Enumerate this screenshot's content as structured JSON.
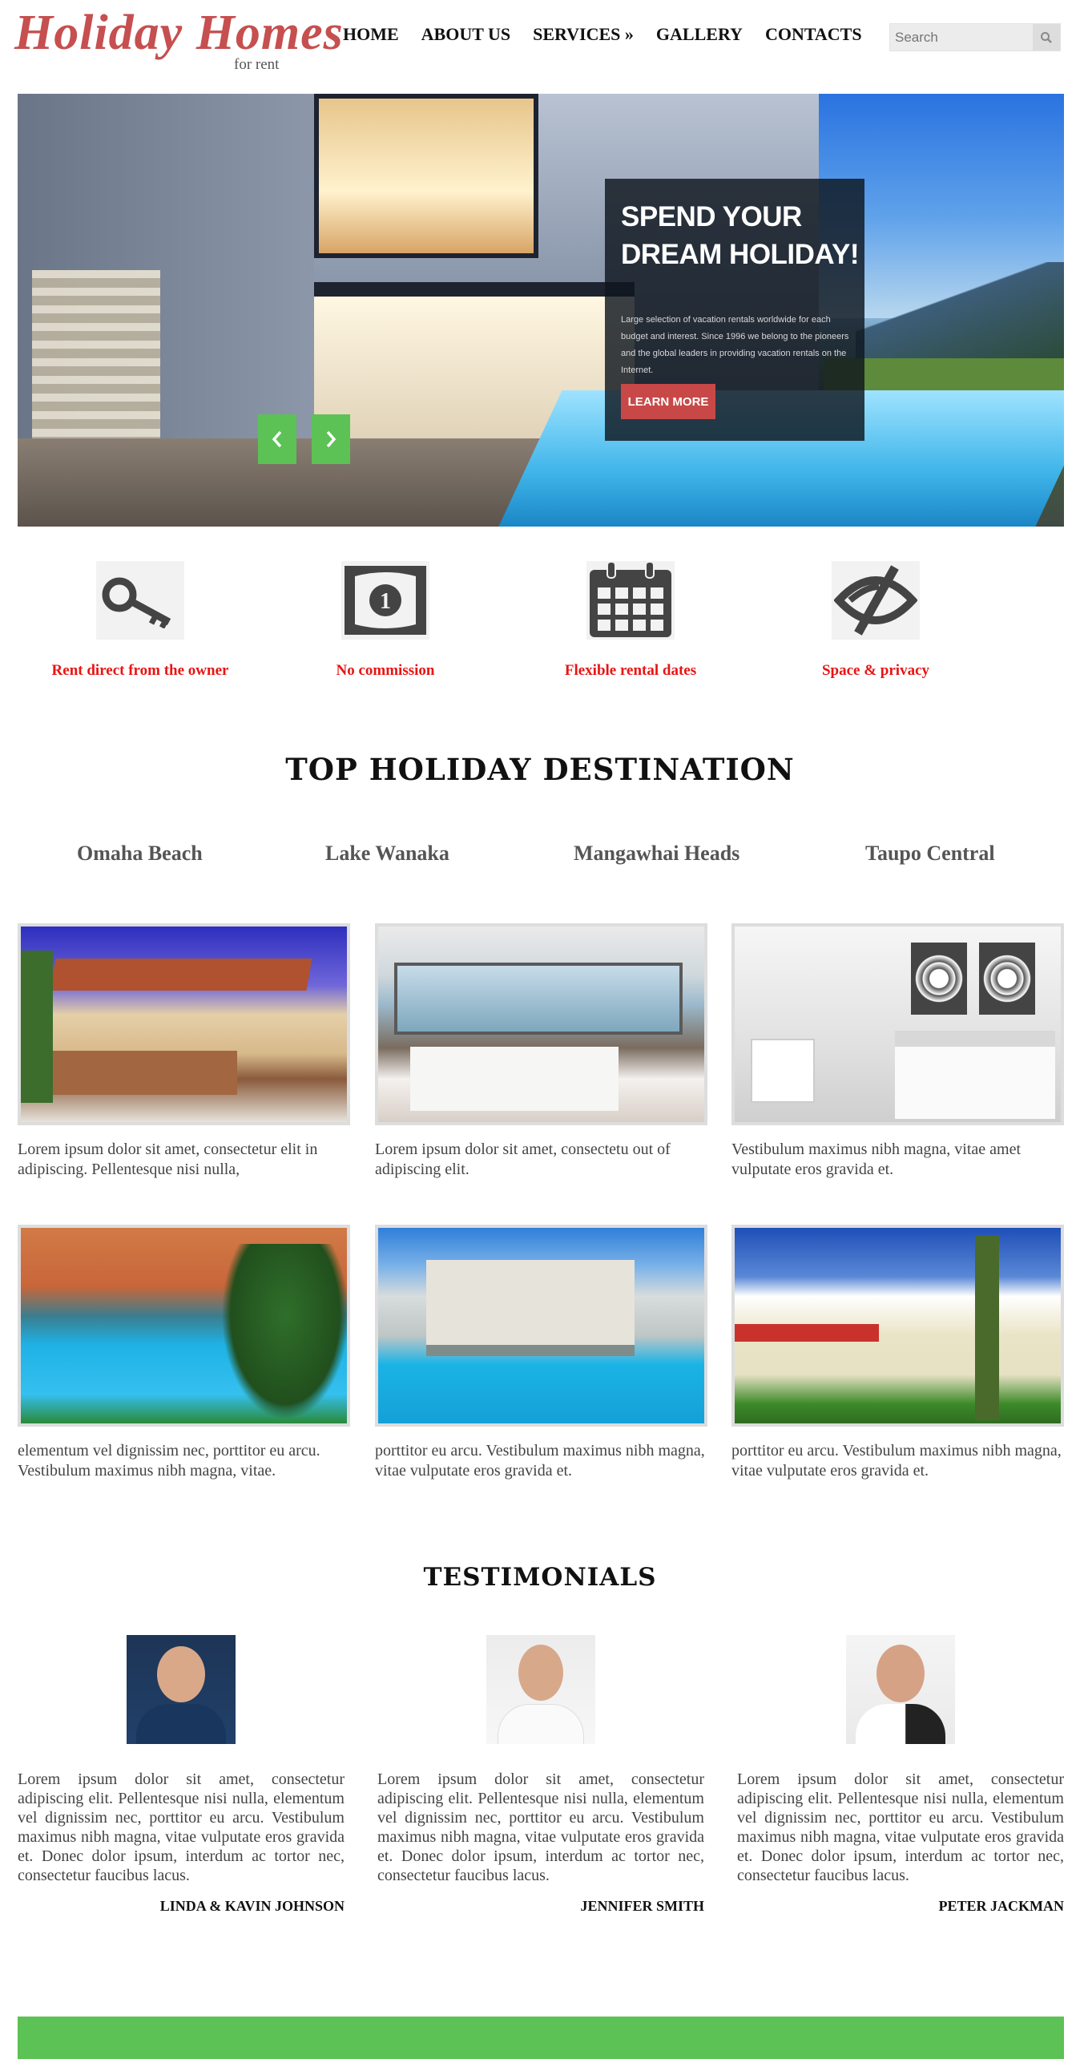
{
  "brand": {
    "title": "Holiday Homes",
    "subtitle": "for rent"
  },
  "nav": {
    "items": [
      "HOME",
      "ABOUT US",
      "SERVICES »",
      "GALLERY",
      "CONTACTS"
    ]
  },
  "search": {
    "placeholder": "Search"
  },
  "hero": {
    "title": "SPEND YOUR DREAM HOLIDAY!",
    "text": "Large selection of vacation rentals worldwide for each budget and interest. Since 1996 we belong to the pioneers and the global leaders in providing vacation rentals on the Internet.",
    "button": "LEARN MORE"
  },
  "features": [
    {
      "label": "Rent direct from the owner",
      "icon": "key-icon"
    },
    {
      "label": "No commission",
      "icon": "banknote-icon"
    },
    {
      "label": "Flexible rental dates",
      "icon": "calendar-icon"
    },
    {
      "label": "Space & privacy",
      "icon": "hidden-eye-icon"
    }
  ],
  "destinations": {
    "title": "TOP HOLIDAY DESTINATION",
    "names": [
      "Omaha Beach",
      "Lake Wanaka",
      "Mangawhai Heads",
      "Taupo Central"
    ]
  },
  "gallery": [
    {
      "caption": "Lorem ipsum dolor sit amet, consectetur elit in adipiscing. Pellentesque nisi nulla,"
    },
    {
      "caption": "Lorem ipsum dolor sit amet, consectetu out of adipiscing elit."
    },
    {
      "caption": "Vestibulum maximus nibh magna, vitae amet vulputate eros gravida et."
    },
    {
      "caption": "elementum vel dignissim nec, porttitor eu arcu. Vestibulum maximus nibh magna, vitae."
    },
    {
      "caption": "porttitor eu arcu. Vestibulum maximus nibh magna, vitae vulputate eros gravida et."
    },
    {
      "caption": "porttitor eu arcu. Vestibulum maximus nibh magna, vitae vulputate eros gravida et."
    }
  ],
  "testimonials": {
    "title": "TESTIMONIALS",
    "items": [
      {
        "text": "Lorem ipsum dolor sit amet, consectetur adipiscing elit. Pellentesque nisi nulla, elementum vel dignissim nec, porttitor eu arcu. Vestibulum maximus nibh magna, vitae vulputate eros gravida et. Donec dolor ipsum, interdum ac tortor nec, consectetur faucibus lacus.",
        "name": "LINDA & KAVIN JOHNSON"
      },
      {
        "text": "Lorem ipsum dolor sit amet, consectetur adipiscing elit. Pellentesque nisi nulla, elementum vel dignissim nec, porttitor eu arcu. Vestibulum maximus nibh magna, vitae vulputate eros gravida et. Donec dolor ipsum, interdum ac tortor nec, consectetur faucibus lacus.",
        "name": "JENNIFER SMITH"
      },
      {
        "text": "Lorem ipsum dolor sit amet, consectetur adipiscing elit. Pellentesque nisi nulla, elementum vel dignissim nec, porttitor eu arcu. Vestibulum maximus nibh magna, vitae vulputate eros gravida et. Donec dolor ipsum, interdum ac tortor nec, consectetur faucibus lacus.",
        "name": "PETER JACKMAN"
      }
    ]
  },
  "colors": {
    "brand": "#c64f4f",
    "accent": "#5cc255",
    "feature_label": "#e81414",
    "button": "#c84848"
  }
}
